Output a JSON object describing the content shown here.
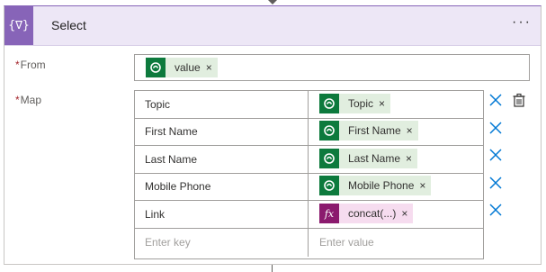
{
  "action": {
    "title": "Select",
    "icon": "select-braces-icon",
    "icon_glyph": "{∇}",
    "more_glyph": "···",
    "header_color": "#ede7f6",
    "accent_color": "#8764b8"
  },
  "from_field": {
    "required_mark": "*",
    "label": "From",
    "token": {
      "label": "value",
      "icon": "dataverse-icon",
      "remove": "×"
    }
  },
  "map_field": {
    "required_mark": "*",
    "label": "Map",
    "rows": [
      {
        "key": "Topic",
        "value": {
          "label": "Topic",
          "icon": "dataverse-icon",
          "remove": "×"
        }
      },
      {
        "key": "First Name",
        "value": {
          "label": "First Name",
          "icon": "dataverse-icon",
          "remove": "×"
        }
      },
      {
        "key": "Last Name",
        "value": {
          "label": "Last Name",
          "icon": "dataverse-icon",
          "remove": "×"
        }
      },
      {
        "key": "Mobile Phone",
        "value": {
          "label": "Mobile Phone",
          "icon": "dataverse-icon",
          "remove": "×"
        }
      },
      {
        "key": "Link",
        "value": {
          "label": "concat(...)",
          "icon": "expression-fx-icon",
          "glyph": "fx",
          "remove": "×"
        }
      }
    ],
    "key_placeholder": "Enter key",
    "value_placeholder": "Enter value"
  },
  "colors": {
    "dataverse_token_bg": "#e1eedf",
    "dataverse_icon_bg": "#0d7a3d",
    "expression_token_bg": "#f6dcef",
    "expression_icon_bg": "#8b1a6e",
    "delete_icon": "#0078d4"
  }
}
